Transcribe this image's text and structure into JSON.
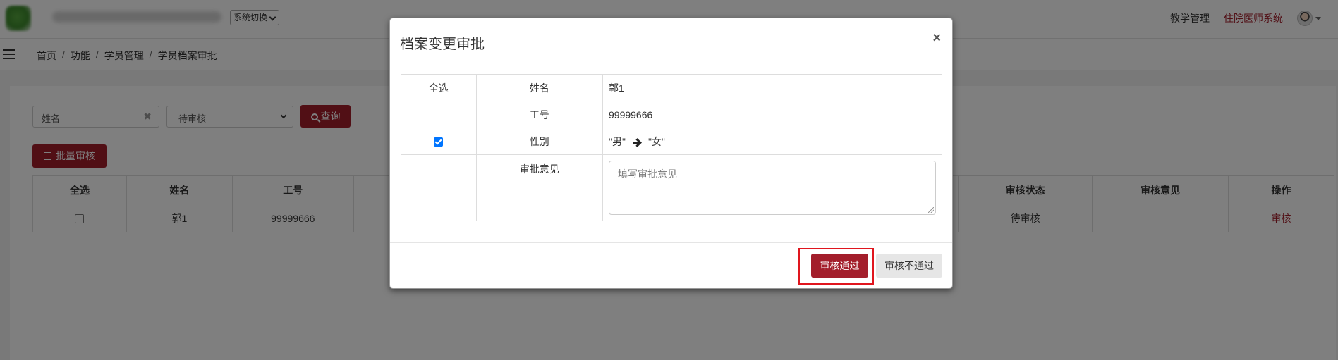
{
  "header": {
    "system_switch": "系统切换",
    "nav_teaching": "教学管理",
    "nav_resident": "住院医师系统",
    "icons": [
      "logo",
      "chevron-down-icon",
      "avatar",
      "caret-down-icon"
    ]
  },
  "breadcrumb": [
    "首页",
    "功能",
    "学员管理",
    "学员档案审批"
  ],
  "filters": {
    "name_placeholder": "姓名",
    "clear_symbol": "✖",
    "status_selected": "待审核",
    "query_button": "查询"
  },
  "toolbar": {
    "batch_button": "批量审核"
  },
  "table": {
    "headers": [
      "全选",
      "姓名",
      "工号",
      "审核状态",
      "审核意见",
      "操作"
    ],
    "rows": [
      {
        "name": "郭1",
        "employee_id": "99999666",
        "status": "待审核",
        "opinion": "",
        "action": "审核"
      }
    ]
  },
  "modal": {
    "title": "档案变更审批",
    "close": "×",
    "select_all": "全选",
    "rows": [
      {
        "field": "姓名",
        "value": "郭1",
        "checkbox": false,
        "checked": false
      },
      {
        "field": "工号",
        "value": "99999666",
        "checkbox": false,
        "checked": false
      },
      {
        "field": "性别",
        "from": "\"男\"",
        "to": "\"女\"",
        "checkbox": true,
        "checked": true
      }
    ],
    "opinion_label": "审批意见",
    "opinion_placeholder": "填写审批意见",
    "approve_button": "审核通过",
    "reject_button": "审核不通过",
    "highlight_color": "#e0161e",
    "accent_color": "#a31e2b"
  }
}
